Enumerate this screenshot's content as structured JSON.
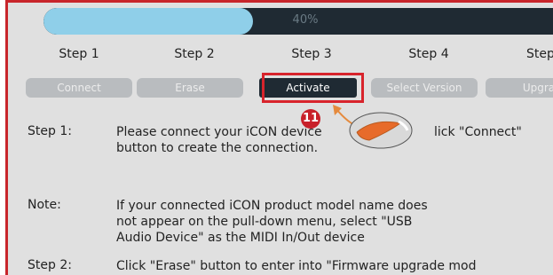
{
  "progress": {
    "value": 0.4,
    "text": "40%"
  },
  "steps": [
    {
      "label": "Step 1"
    },
    {
      "label": "Step 2"
    },
    {
      "label": "Step 3"
    },
    {
      "label": "Step 4"
    },
    {
      "label": "Step"
    }
  ],
  "buttons": [
    {
      "label": "Connect"
    },
    {
      "label": "Erase"
    },
    {
      "label": "Activate"
    },
    {
      "label": "Select Version"
    },
    {
      "label": "Upgra"
    }
  ],
  "annotation": {
    "badge": "11"
  },
  "instructions": [
    {
      "label": "Step 1:",
      "lines": [
        "Please connect your iCON device",
        "lick \"Connect\"",
        "button to create the connection."
      ]
    },
    {
      "label": "Note:",
      "lines": [
        "If your connected iCON product model name does",
        "not appear on the pull-down menu, select \"USB",
        "Audio Device\" as the MIDI In/Out device"
      ]
    },
    {
      "label": "Step 2:",
      "lines": [
        "Click \"Erase\" button to enter into \"Firmware upgrade mod"
      ]
    }
  ],
  "colors": {
    "highlight": "#d8242c",
    "progress_fill": "#8fcfe9",
    "progress_track": "#1f2a33",
    "active_button": "#1f2a33"
  }
}
